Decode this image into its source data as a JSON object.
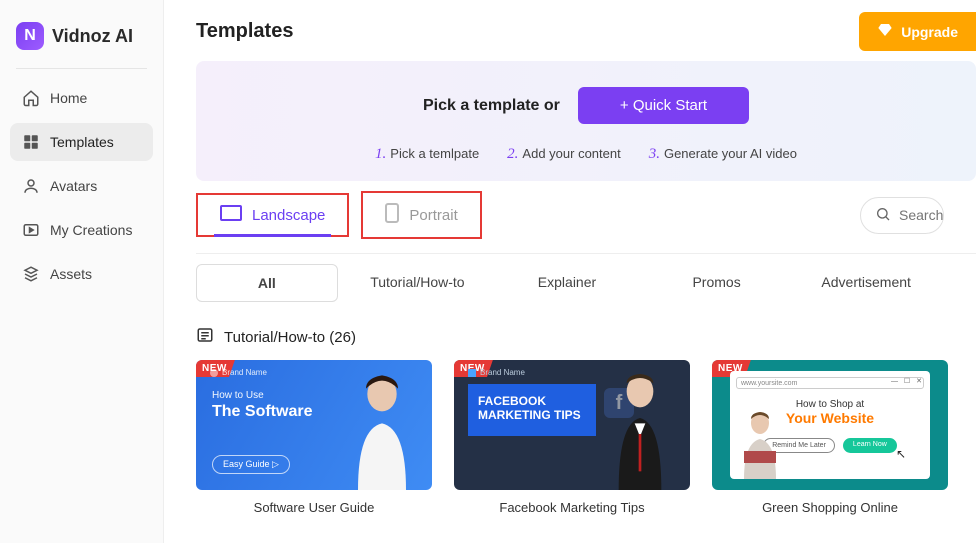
{
  "brand": {
    "name": "Vidnoz AI",
    "logo_letter": "N"
  },
  "sidebar": {
    "items": [
      {
        "label": "Home",
        "icon": "home-icon"
      },
      {
        "label": "Templates",
        "icon": "templates-icon"
      },
      {
        "label": "Avatars",
        "icon": "avatars-icon"
      },
      {
        "label": "My Creations",
        "icon": "creations-icon"
      },
      {
        "label": "Assets",
        "icon": "assets-icon"
      }
    ],
    "active_index": 1
  },
  "header": {
    "title": "Templates",
    "upgrade_label": "Upgrade"
  },
  "hero": {
    "pick_text": "Pick a template or",
    "quick_start_label": "+ Quick Start",
    "steps": [
      {
        "num": "1.",
        "text": "Pick a temlpate"
      },
      {
        "num": "2.",
        "text": "Add your content"
      },
      {
        "num": "3.",
        "text": "Generate your AI video"
      }
    ]
  },
  "orientation": {
    "landscape_label": "Landscape",
    "portrait_label": "Portrait",
    "active": "landscape"
  },
  "search": {
    "placeholder": "Search"
  },
  "category_tabs": [
    {
      "label": "All",
      "active": true
    },
    {
      "label": "Tutorial/How-to",
      "active": false
    },
    {
      "label": "Explainer",
      "active": false
    },
    {
      "label": "Promos",
      "active": false
    },
    {
      "label": "Advertisement",
      "active": false
    }
  ],
  "section": {
    "title": "Tutorial/How-to (26)"
  },
  "templates": [
    {
      "title": "Software User Guide",
      "badge": "NEW",
      "thumb": {
        "brand": "Brand Name",
        "line1": "How to Use",
        "line2": "The Software",
        "chip": "Easy Guide ▷"
      }
    },
    {
      "title": "Facebook Marketing Tips",
      "badge": "NEW",
      "thumb": {
        "brand": "Brand Name",
        "line1": "FACEBOOK",
        "line2": "MARKETING TIPS"
      }
    },
    {
      "title": "Green Shopping Online",
      "badge": "NEW",
      "thumb": {
        "url": "www.yoursite.com",
        "win": "— ☐ ✕",
        "line1": "How to Shop at",
        "line2": "Your Website",
        "btn_outline": "Remind Me Later",
        "btn_fill": "Learn Now"
      }
    }
  ],
  "colors": {
    "accent": "#7b3ff2",
    "upgrade": "#ffa500",
    "highlight_box": "#e53935"
  }
}
